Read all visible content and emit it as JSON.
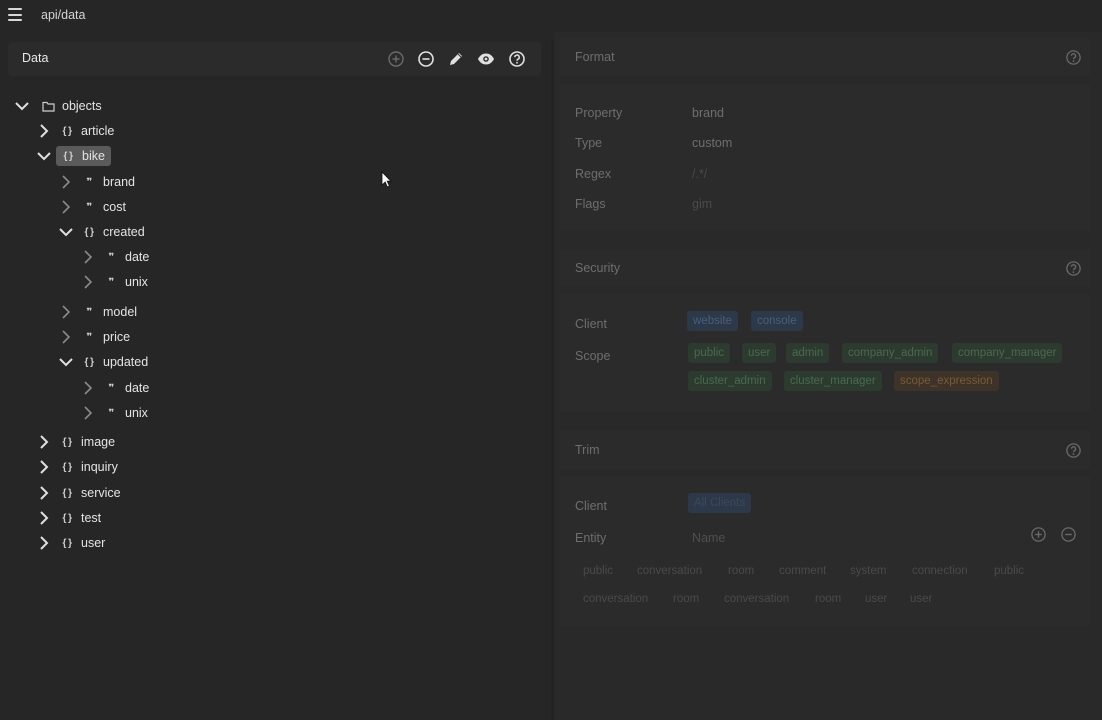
{
  "topbar": {
    "breadcrumb": "api/data"
  },
  "data_panel": {
    "title": "Data",
    "root": "objects",
    "items": [
      {
        "label": "article",
        "type": "object"
      },
      {
        "label": "bike",
        "type": "object"
      },
      {
        "label": "brand",
        "type": "string"
      },
      {
        "label": "cost",
        "type": "string"
      },
      {
        "label": "created",
        "type": "object"
      },
      {
        "label": "date",
        "type": "string"
      },
      {
        "label": "unix",
        "type": "string"
      },
      {
        "label": "model",
        "type": "string"
      },
      {
        "label": "price",
        "type": "string"
      },
      {
        "label": "updated",
        "type": "object"
      },
      {
        "label": "date",
        "type": "string"
      },
      {
        "label": "unix",
        "type": "string"
      },
      {
        "label": "image",
        "type": "object"
      },
      {
        "label": "inquiry",
        "type": "object"
      },
      {
        "label": "service",
        "type": "object"
      },
      {
        "label": "test",
        "type": "object"
      },
      {
        "label": "user",
        "type": "object"
      }
    ]
  },
  "format": {
    "title": "Format",
    "property_label": "Property",
    "property_value": "brand",
    "type_label": "Type",
    "type_value": "custom",
    "regex_label": "Regex",
    "regex_value": "/.*/",
    "flags_label": "Flags",
    "flags_value": "gim"
  },
  "security": {
    "title": "Security",
    "client_label": "Client",
    "clients": [
      "website",
      "console"
    ],
    "scope_label": "Scope",
    "scopes_row1": [
      "public",
      "user",
      "admin",
      "company_admin",
      "company_manager"
    ],
    "scopes_row2": [
      "cluster_admin",
      "cluster_manager"
    ],
    "scope_expression": "scope_expression"
  },
  "trim": {
    "title": "Trim",
    "client_label": "Client",
    "client_value": "All Clients",
    "entity_label": "Entity",
    "entity_placeholder": "Name",
    "tags_row1": [
      "public",
      "conversation",
      "room",
      "comment",
      "system",
      "connection",
      "public"
    ],
    "tags_row2": [
      "conversation",
      "room",
      "conversation",
      "room",
      "user",
      "user"
    ]
  },
  "colors": {
    "background": "#262626",
    "panel": "#2b2b2b",
    "accent_blue": "#2d3848",
    "accent_green": "#2c3a2f",
    "accent_orange": "#3d3329"
  }
}
